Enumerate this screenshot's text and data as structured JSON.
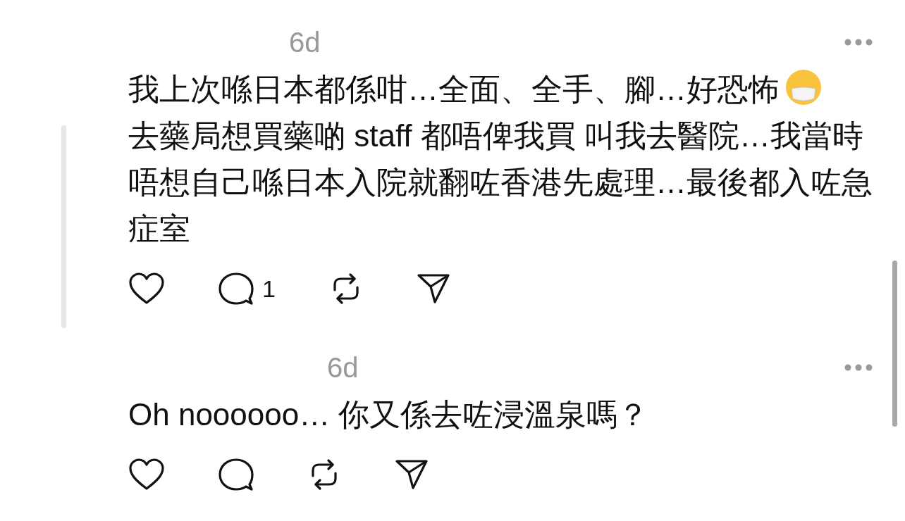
{
  "comments": [
    {
      "time": "6d",
      "paragraphs": [
        "我上次喺日本都係咁…全面、全手、腳…好恐怖",
        "去藥局想買藥啲 staff 都唔俾我買 叫我去醫院…我當時唔想自己喺日本入院就翻咗香港先處理…最後都入咗急症室"
      ],
      "emoji_end": true,
      "has_replies": true,
      "reply_count": "1"
    },
    {
      "time": "6d",
      "paragraphs": [
        "Oh noooooo… 你又係去咗浸溫泉嗎？"
      ],
      "emoji_end": false,
      "has_replies": false
    }
  ]
}
